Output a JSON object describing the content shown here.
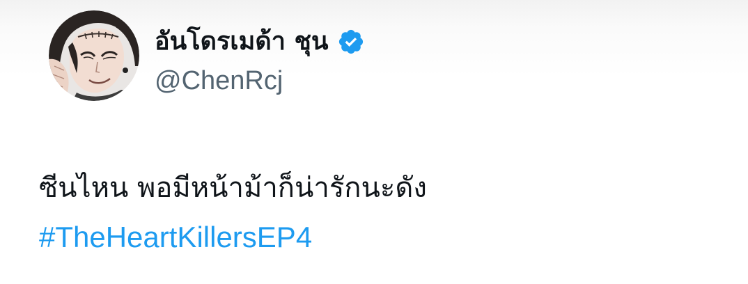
{
  "tweet": {
    "author": {
      "display_name": "อันโดรเมด้า ชุน",
      "handle": "@ChenRcj",
      "verified": true,
      "verified_icon": "verified-badge-icon",
      "verified_color": "#1d9bf0"
    },
    "text": "ซีนไหน พอมีหน้าม้าก็น่ารักนะดัง",
    "hashtag": "#TheHeartKillersEP4",
    "hashtag_color": "#1d9bf0"
  }
}
